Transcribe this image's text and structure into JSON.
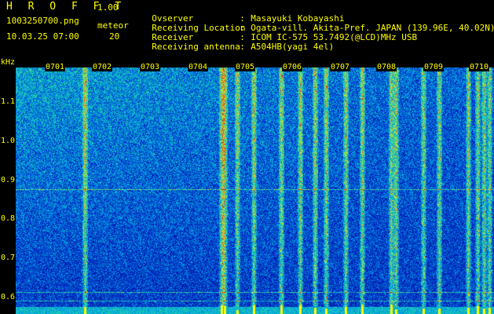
{
  "header": {
    "app_title": "H R O F F T",
    "app_version": "1.00",
    "filename": "1003250700.png",
    "meteor_label": "meteor",
    "datetime": "10.03.25 07:00",
    "meteor_count": "20"
  },
  "info": [
    {
      "key": "Ovserver",
      "sep": ":",
      "value": "Masayuki Kobayashi"
    },
    {
      "key": "Receiving Location",
      "sep": ":",
      "value": "Ogata-vill. Akita-Pref. JAPAN (139.96E, 40.02N)"
    },
    {
      "key": "Receiver",
      "sep": ":",
      "value": "ICOM IC-575 53.7492(@LCD)MHz USB"
    },
    {
      "key": "Receiving antenna",
      "sep": ":",
      "value": "A504HB(yagi 4el)"
    }
  ],
  "y_axis": {
    "unit": "kHz",
    "ticks": [
      "1.1",
      "1.0",
      "0.9",
      "0.8",
      "0.7",
      "0.6"
    ]
  },
  "time_labels": [
    "0701",
    "0702",
    "0703",
    "0704",
    "0705",
    "0706",
    "0707",
    "0708",
    "0709",
    "0710"
  ],
  "colors": {
    "text": "#ffff00",
    "background": "#000000"
  }
}
